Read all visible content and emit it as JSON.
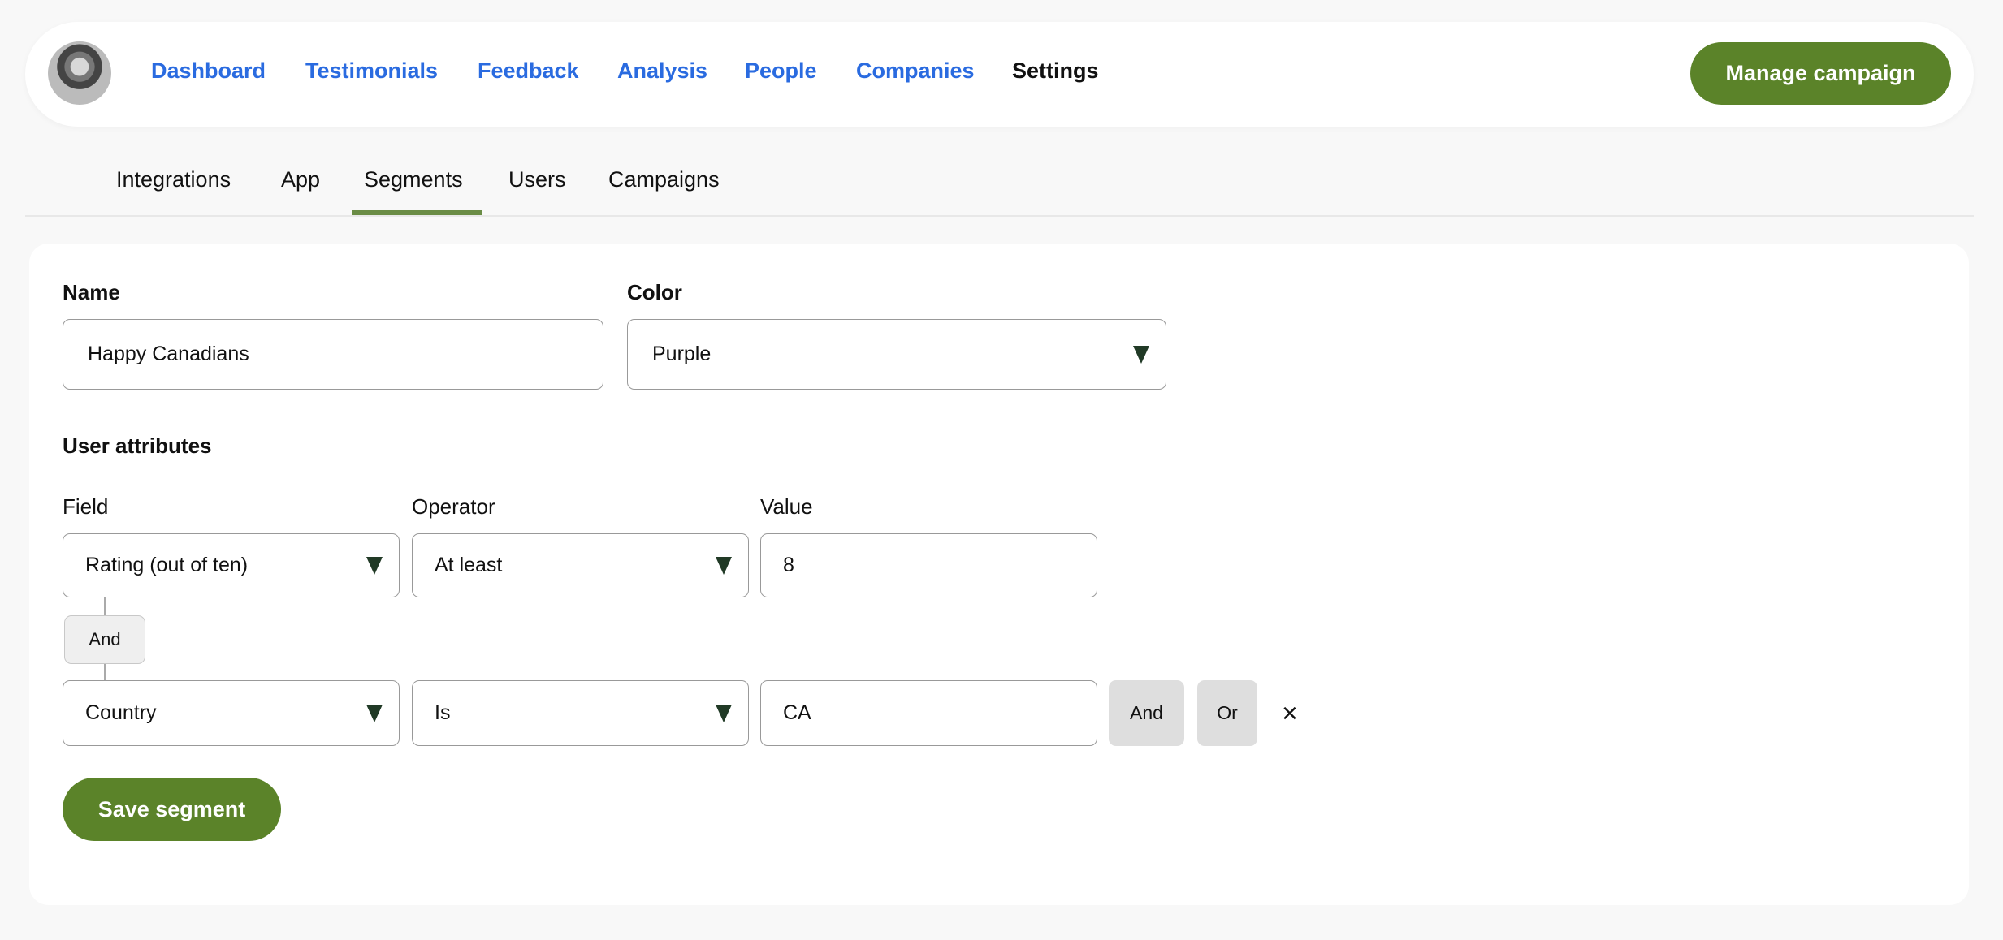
{
  "header": {
    "nav": [
      "Dashboard",
      "Testimonials",
      "Feedback",
      "Analysis",
      "People",
      "Companies",
      "Settings"
    ],
    "active_nav": "Settings",
    "manage_label": "Manage campaign"
  },
  "tabs": {
    "items": [
      "Integrations",
      "App",
      "Segments",
      "Users",
      "Campaigns"
    ],
    "active": "Segments"
  },
  "form": {
    "name_label": "Name",
    "name_value": "Happy Canadians",
    "color_label": "Color",
    "color_value": "Purple",
    "attributes_heading": "User attributes",
    "field_label": "Field",
    "operator_label": "Operator",
    "value_label": "Value",
    "rows": [
      {
        "field": "Rating (out of ten)",
        "operator": "At least",
        "value": "8"
      },
      {
        "field": "Country",
        "operator": "Is",
        "value": "CA"
      }
    ],
    "connector": "And",
    "and_label": "And",
    "or_label": "Or",
    "remove_glyph": "×",
    "save_label": "Save segment"
  },
  "colors": {
    "accent": "#5b8329",
    "link": "#2a6be0"
  }
}
